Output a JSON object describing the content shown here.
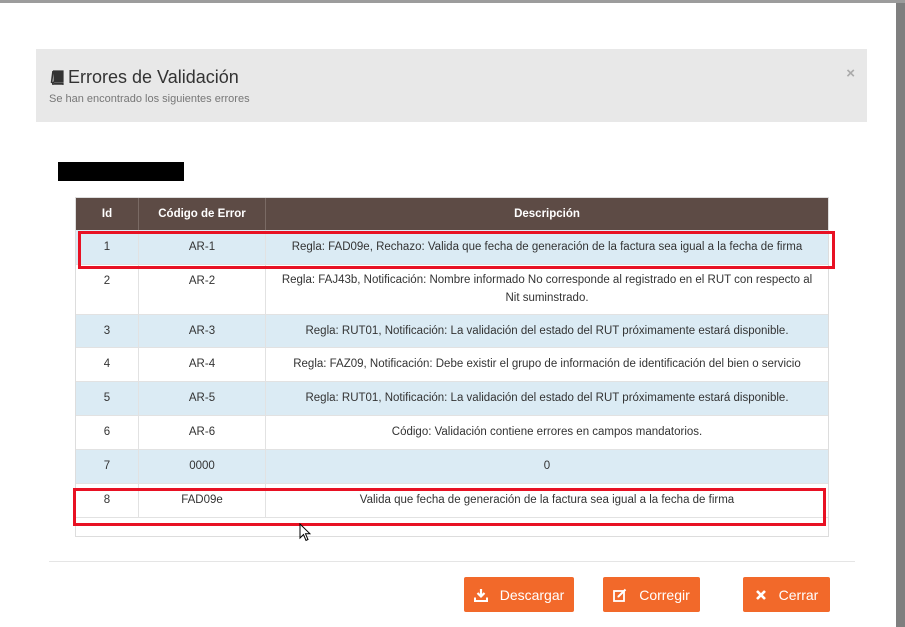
{
  "modal": {
    "title": "Errores de Validación",
    "subtitle": "Se han encontrado los siguientes errores",
    "close_label": "×"
  },
  "table": {
    "headers": [
      "Id",
      "Código de Error",
      "Descripción"
    ],
    "rows": [
      {
        "id": "1",
        "code": "AR-1",
        "description": "Regla: FAD09e, Rechazo: Valida que fecha de generación de la factura sea igual a la fecha de firma"
      },
      {
        "id": "2",
        "code": "AR-2",
        "description": "Regla: FAJ43b, Notificación: Nombre informado No corresponde al registrado en el RUT con respecto al Nit suminstrado."
      },
      {
        "id": "3",
        "code": "AR-3",
        "description": "Regla: RUT01, Notificación: La validación del estado del RUT próximamente estará disponible."
      },
      {
        "id": "4",
        "code": "AR-4",
        "description": "Regla: FAZ09, Notificación: Debe existir el grupo de información de identificación del bien o servicio"
      },
      {
        "id": "5",
        "code": "AR-5",
        "description": "Regla: RUT01, Notificación: La validación del estado del RUT próximamente estará disponible."
      },
      {
        "id": "6",
        "code": "AR-6",
        "description": "Código: Validación contiene errores en campos mandatorios."
      },
      {
        "id": "7",
        "code": "0000",
        "description": "0"
      },
      {
        "id": "8",
        "code": "FAD09e",
        "description": "Valida que fecha de generación de la factura sea igual a la fecha de firma"
      }
    ]
  },
  "buttons": {
    "download": "Descargar",
    "correct": "Corregir",
    "close": "Cerrar"
  },
  "colors": {
    "accent": "#f2692a",
    "header_bg": "#5d4b45",
    "row_alt": "#dbebf4",
    "highlight": "#e81123"
  }
}
